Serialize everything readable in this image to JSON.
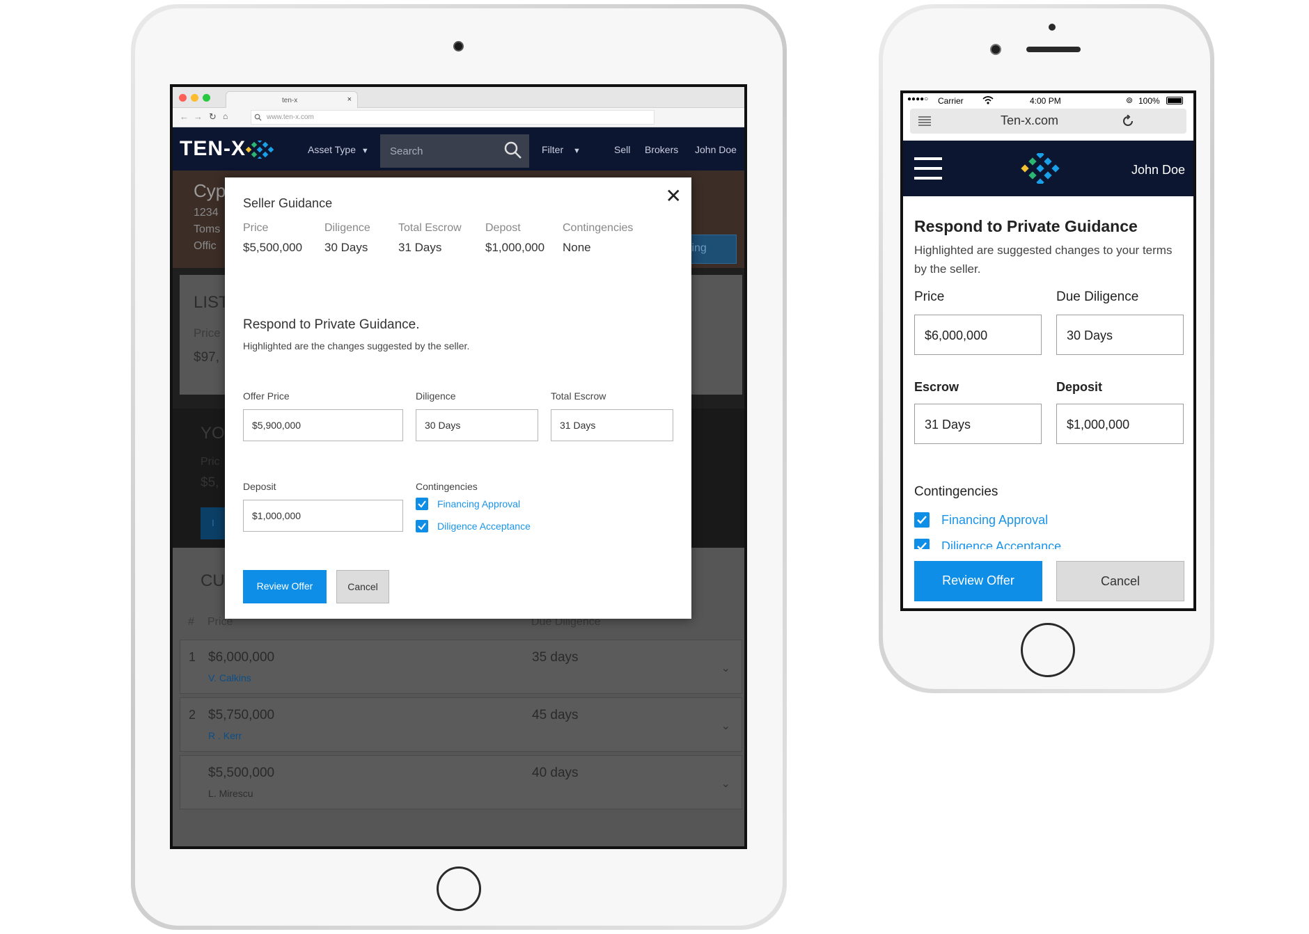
{
  "tablet": {
    "browser": {
      "tab_title": "ten-x",
      "tab_close": "×",
      "url": "www.ten-x.com"
    },
    "header": {
      "logo": "TEN-X",
      "asset_type": "Asset Type",
      "search_placeholder": "Search",
      "filter": "Filter",
      "sell": "Sell",
      "brokers": "Brokers",
      "user": "John Doe"
    },
    "background": {
      "hero_title": "Cyp",
      "hero_line1": "1234",
      "hero_line2": "Toms",
      "hero_line3": "Offic",
      "hero_button": "ting",
      "listing_title": "LIST",
      "listing_price_label": "Price",
      "listing_price": "$97,",
      "your_title": "YO",
      "your_price_label": "Pric",
      "your_price": "$5,",
      "your_button": "I",
      "current_title": "CU",
      "table_header": {
        "num": "#",
        "price": "Price",
        "due": "Due Diligence"
      },
      "rows": [
        {
          "num": "1",
          "price": "$6,000,000",
          "name": "V. Calkins",
          "days": "35 days"
        },
        {
          "num": "2",
          "price": "$5,750,000",
          "name": "R . Kerr",
          "days": "45 days"
        },
        {
          "num": "",
          "price": "$5,500,000",
          "name": "L. Mirescu",
          "days": "40 days"
        }
      ]
    },
    "modal": {
      "title": "Seller Guidance",
      "close": "✕",
      "guidance": [
        {
          "label": "Price",
          "value": "$5,500,000"
        },
        {
          "label": "Diligence",
          "value": "30 Days"
        },
        {
          "label": "Total Escrow",
          "value": "31 Days"
        },
        {
          "label": "Depost",
          "value": "$1,000,000"
        },
        {
          "label": "Contingencies",
          "value": "None"
        }
      ],
      "respond_title": "Respond to Private Guidance.",
      "respond_sub": "Highlighted are the changes suggested by the seller.",
      "fields": {
        "offer_price": {
          "label": "Offer Price",
          "value": "$5,900,000"
        },
        "diligence": {
          "label": "Diligence",
          "value": "30 Days"
        },
        "total_escrow": {
          "label": "Total Escrow",
          "value": "31 Days"
        },
        "deposit": {
          "label": "Deposit",
          "value": "$1,000,000"
        }
      },
      "contingencies_label": "Contingencies",
      "contingencies": [
        {
          "label": "Financing Approval",
          "checked": true
        },
        {
          "label": "Diligence Acceptance",
          "checked": true
        }
      ],
      "review_button": "Review Offer",
      "cancel_button": "Cancel"
    }
  },
  "phone": {
    "status": {
      "signal": "●●●●○",
      "carrier": "Carrier",
      "time": "4:00 PM",
      "battery": "100%"
    },
    "url": "Ten-x.com",
    "header": {
      "user": "John Doe"
    },
    "title": "Respond to Private Guidance",
    "subtitle": "Highlighted are suggested changes to your terms by the seller.",
    "fields": {
      "price": {
        "label": "Price",
        "value": "$6,000,000"
      },
      "due_diligence": {
        "label": "Due Diligence",
        "value": "30 Days"
      },
      "escrow": {
        "label": "Escrow",
        "value": "31 Days"
      },
      "deposit": {
        "label": "Deposit",
        "value": "$1,000,000"
      }
    },
    "contingencies_label": "Contingencies",
    "contingencies": [
      {
        "label": "Financing Approval",
        "checked": true
      },
      {
        "label": "Diligence Acceptance",
        "checked": true
      }
    ],
    "review_button": "Review Offer",
    "cancel_button": "Cancel"
  },
  "colors": {
    "brand_navy": "#0d1630",
    "accent_blue": "#0e8ee6",
    "link_blue": "#1a94e8"
  }
}
